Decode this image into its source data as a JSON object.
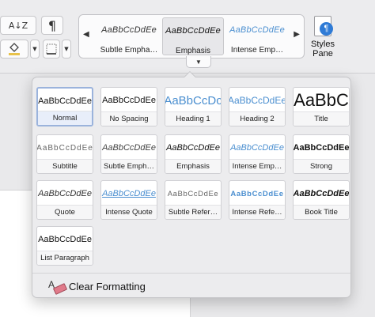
{
  "ribbon": {
    "sort_label": "A↓Z",
    "pilcrow_label": "¶",
    "styles_pane_label": "Styles Pane",
    "gallery": [
      {
        "sample": "AaBbCcDdEe",
        "name": "Subtle Empha…",
        "color": "#333333"
      },
      {
        "sample": "AaBbCcDdEe",
        "name": "Emphasis",
        "color": "#111111"
      },
      {
        "sample": "AaBbCcDdEe",
        "name": "Intense Emp…",
        "color": "#4b8fd0"
      }
    ],
    "gallery_left_arrow": "◀",
    "gallery_right_arrow": "▶",
    "expand_arrow": "▼"
  },
  "styles": [
    {
      "sample": "AaBbCcDdEe",
      "name": "Normal",
      "selected": true
    },
    {
      "sample": "AaBbCcDdEe",
      "name": "No Spacing"
    },
    {
      "sample": "AaBbCcDc",
      "name": "Heading 1"
    },
    {
      "sample": "AaBbCcDdEe",
      "name": "Heading 2"
    },
    {
      "sample": "AaBbC",
      "name": "Title"
    },
    {
      "sample": "AaBbCcDdEe",
      "name": "Subtitle"
    },
    {
      "sample": "AaBbCcDdEe",
      "name": "Subtle Emph…"
    },
    {
      "sample": "AaBbCcDdEe",
      "name": "Emphasis"
    },
    {
      "sample": "AaBbCcDdEe",
      "name": "Intense Emp…"
    },
    {
      "sample": "AaBbCcDdEe",
      "name": "Strong"
    },
    {
      "sample": "AaBbCcDdEe",
      "name": "Quote"
    },
    {
      "sample": "AaBbCcDdEe",
      "name": "Intense Quote"
    },
    {
      "sample": "AaBbCcDdEe",
      "name": "Subtle Refer…"
    },
    {
      "sample": "AaBbCcDdEe",
      "name": "Intense Refe…"
    },
    {
      "sample": "AaBbCcDdEe",
      "name": "Book Title"
    },
    {
      "sample": "AaBbCcDdEe",
      "name": "List Paragraph"
    }
  ],
  "clear_formatting_label": "Clear Formatting",
  "colors": {
    "accent_blue": "#4b8fd0",
    "selection_border": "#9bb3dc"
  }
}
